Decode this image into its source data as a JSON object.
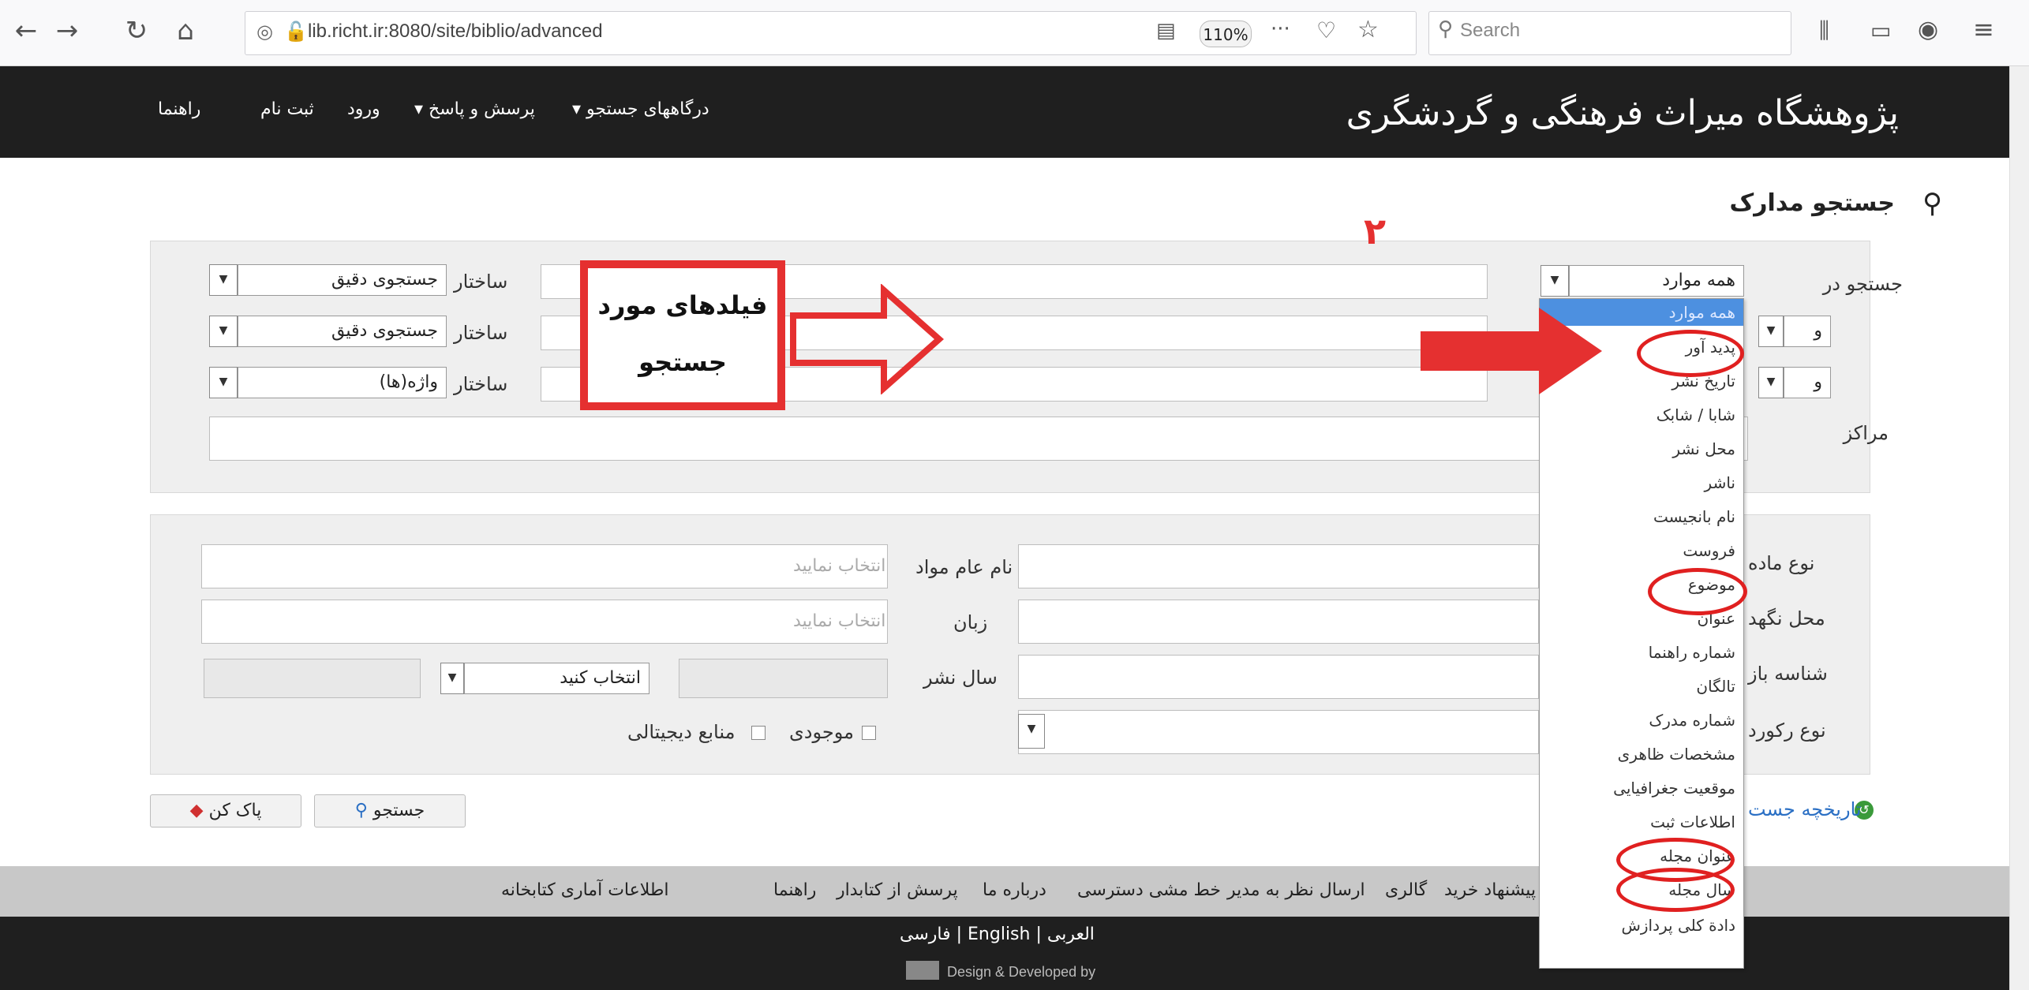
{
  "browser": {
    "url": "lib.richt.ir:8080/site/biblio/advanced",
    "zoom": "110%",
    "search_placeholder": "Search"
  },
  "site": {
    "title": "پژوهشگاه میراث فرهنگی و گردشگری",
    "nav": [
      "درگاههای جستجو ▾",
      "پرسش و پاسخ ▾",
      "ورود",
      "ثبت نام",
      "راهنما"
    ]
  },
  "page_title": "جستجو مدارک",
  "search_panel": {
    "search_in_label": "جستجو در",
    "search_in_value": "همه موارد",
    "and_1": "و",
    "and_2": "و",
    "centers_label": "مراکز",
    "structure_label": "ساختار",
    "structure_values": [
      "جستجوی دقیق",
      "جستجوی دقیق",
      "واژه(ها)"
    ]
  },
  "dropdown_options": [
    "همه موارد",
    "پدید آور",
    "تاریخ نشر",
    "شابا / شابک",
    "محل نشر",
    "ناشر",
    "نام بانجیست",
    "فروست",
    "موضوع",
    "عنوان",
    "شماره راهنما",
    "تالگان",
    "شماره مدرک",
    "مشخصات ظاهری",
    "موقعیت جغرافیایی",
    "اطلاعات ثبت",
    "عنوان مجله",
    "سال مجله",
    "دادة کلی پردازش"
  ],
  "filter_panel": {
    "material_type_label": "نوع ماده",
    "location_label": "محل نگهد",
    "identifier_label": "شناسه باز",
    "record_type_label": "نوع رکورد",
    "general_material_label": "نام عام مواد",
    "language_label": "زبان",
    "pub_year_label": "سال نشر",
    "select_placeholder_1": "انتخاب نمایید",
    "select_placeholder_2": "انتخاب نمایید",
    "choose_label": "انتخاب کنید",
    "available_label": "موجودی",
    "digital_label": "منابع دیجیتالی"
  },
  "buttons": {
    "search": "جستجو",
    "clear": "پاک کن"
  },
  "history_label": "تاریخچه جست",
  "annotation": {
    "callout_line1": "فیلدهای مورد",
    "callout_line2": "جستجو",
    "number": "۲"
  },
  "footer": {
    "links": [
      "پیشنهاد خرید",
      "گالری",
      "ارسال نظر به مدیر",
      "خط مشی دسترسی",
      "درباره ما",
      "پرسش از کتابدار",
      "راهنما",
      "اطلاعات آماری کتابخانه"
    ],
    "languages": "فارسی | English | العربی",
    "design": "Design & Developed by"
  },
  "colors": {
    "header_bg": "#1f1f1f",
    "accent_red": "#e53030",
    "selected_blue": "#4d90e0"
  }
}
